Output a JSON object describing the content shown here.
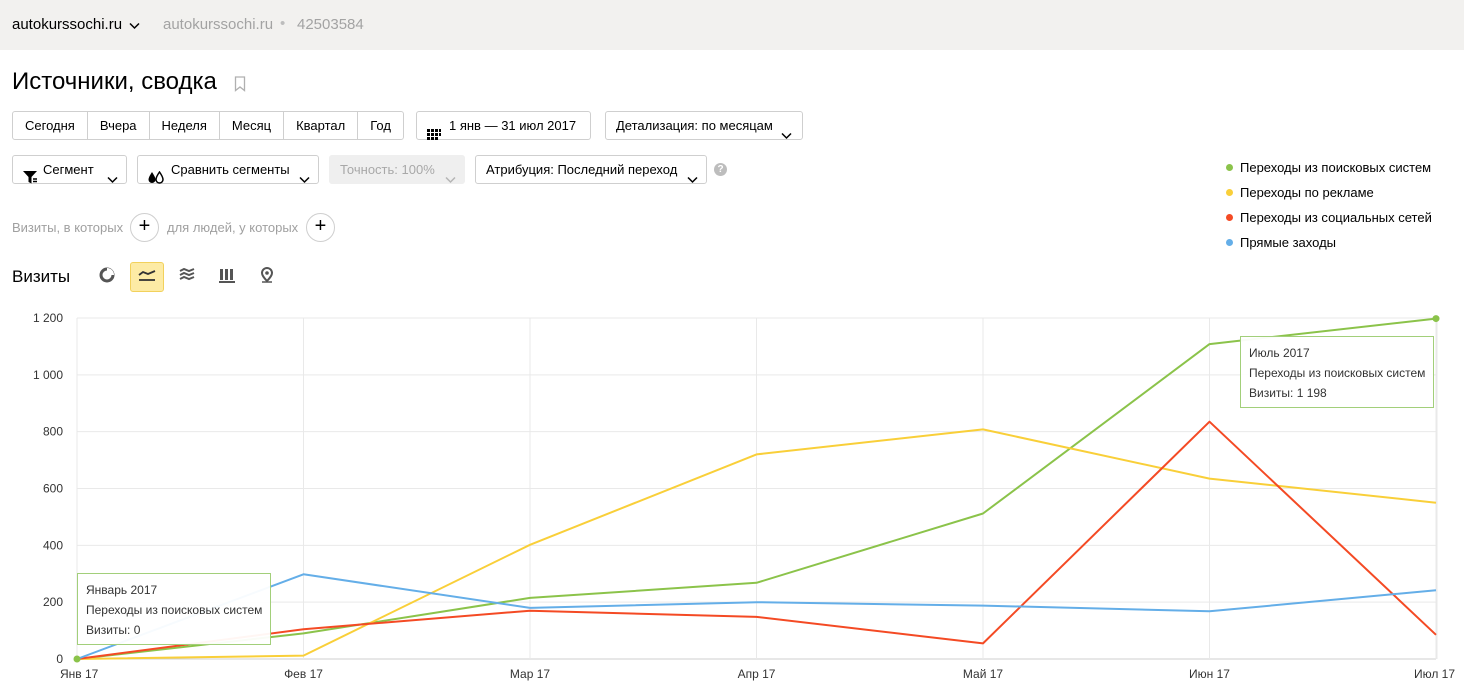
{
  "header": {
    "site_name": "autokurssochi.ru",
    "site_sub": "autokurssochi.ru",
    "separator": "•",
    "counter_id": "42503584"
  },
  "page_title": "Источники, сводка",
  "periods": [
    "Сегодня",
    "Вчера",
    "Неделя",
    "Месяц",
    "Квартал",
    "Год"
  ],
  "date_range": "1 янв — 31 июл 2017",
  "detail": "Детализация: по месяцам",
  "filters": {
    "segment": "Сегмент",
    "compare": "Сравнить сегменты",
    "accuracy": "Точность: 100%",
    "attribution": "Атрибуция: Последний переход",
    "help": "?"
  },
  "conditions": {
    "visits_label": "Визиты, в которых",
    "people_label": "для людей, у которых",
    "plus": "+"
  },
  "visits_title": "Визиты",
  "chart_tools": [
    "pie-chart-icon",
    "line-chart-icon",
    "area-chart-icon",
    "bar-chart-icon",
    "map-icon"
  ],
  "colors": {
    "search": "#8bc34a",
    "ads": "#f9cf39",
    "social": "#f44a24",
    "direct": "#64aee8",
    "tooltip_border": "#a2cf7a",
    "active_tool": "#fdeba5"
  },
  "chart_data": {
    "type": "line",
    "categories": [
      "Янв 17",
      "Фев 17",
      "Мар 17",
      "Апр 17",
      "Май 17",
      "Июн 17",
      "Июл 17"
    ],
    "y_ticks": [
      "0",
      "200",
      "400",
      "600",
      "800",
      "1 000",
      "1 200"
    ],
    "ylim": [
      0,
      1200
    ],
    "grid": true,
    "legend_position": "top-right",
    "series": [
      {
        "name": "Переходы из поисковых систем",
        "color": "#8bc34a",
        "values": [
          0,
          90,
          215,
          268,
          512,
          1108,
          1198
        ]
      },
      {
        "name": "Переходы по рекламе",
        "color": "#f9cf39",
        "values": [
          0,
          12,
          402,
          720,
          808,
          635,
          550
        ]
      },
      {
        "name": "Переходы из социальных сетей",
        "color": "#f44a24",
        "values": [
          0,
          105,
          170,
          148,
          55,
          835,
          85
        ]
      },
      {
        "name": "Прямые заходы",
        "color": "#64aee8",
        "values": [
          0,
          298,
          180,
          200,
          188,
          168,
          242
        ]
      }
    ],
    "tooltips": [
      {
        "lines": [
          "Январь 2017",
          "Переходы из поисковых систем",
          "Визиты: 0"
        ]
      },
      {
        "lines": [
          "Июль 2017",
          "Переходы из поисковых систем",
          "Визиты: 1 198"
        ]
      }
    ]
  }
}
